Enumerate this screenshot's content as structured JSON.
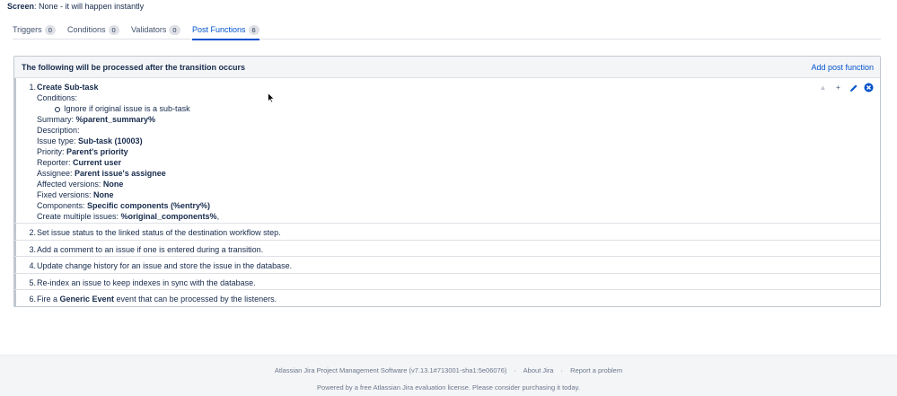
{
  "screen": {
    "label": "Screen",
    "value": ": None - it will happen instantly"
  },
  "tabs": [
    {
      "label": "Triggers",
      "count": "0"
    },
    {
      "label": "Conditions",
      "count": "0"
    },
    {
      "label": "Validators",
      "count": "0"
    },
    {
      "label": "Post Functions",
      "count": "6"
    }
  ],
  "panel": {
    "title": "The following will be processed after the transition occurs",
    "add_label": "Add post function"
  },
  "function1": {
    "num": "1.",
    "title": "Create Sub-task",
    "conditions_label": "Conditions:",
    "condition_item": "Ignore if original issue is a sub-task",
    "fields": [
      {
        "label": "Summary: ",
        "value": "%parent_summary%"
      },
      {
        "label": "Description:",
        "value": ""
      },
      {
        "label": "Issue type: ",
        "value": "Sub-task (10003)"
      },
      {
        "label": "Priority: ",
        "value": "Parent's priority"
      },
      {
        "label": "Reporter: ",
        "value": "Current user"
      },
      {
        "label": "Assignee: ",
        "value": "Parent issue's assignee"
      },
      {
        "label": "Affected versions: ",
        "value": "None"
      },
      {
        "label": "Fixed versions: ",
        "value": "None"
      },
      {
        "label": "Components: ",
        "value": "Specific components (%entry%)"
      },
      {
        "label": "Create multiple issues: ",
        "value": "%original_components%",
        "suffix": ","
      }
    ]
  },
  "functions": [
    {
      "num": "2.",
      "text": "Set issue status to the linked status of the destination workflow step."
    },
    {
      "num": "3.",
      "text": "Add a comment to an issue if one is entered during a transition."
    },
    {
      "num": "4.",
      "text": "Update change history for an issue and store the issue in the database."
    },
    {
      "num": "5.",
      "text": "Re-index an issue to keep indexes in sync with the database."
    },
    {
      "num": "6.",
      "pre": "Fire a ",
      "bold": "Generic Event",
      "post": " event that can be processed by the listeners."
    }
  ],
  "actions": {
    "move_up": "▲",
    "move_down": "+"
  },
  "footer": {
    "software": "Atlassian Jira Project Management Software (v7.13.1#713001-sha1:5e06076)",
    "about": "About Jira",
    "report": "Report a problem",
    "license": "Powered by a free Atlassian Jira evaluation license. Please consider purchasing it today.",
    "sep": "·"
  },
  "colors": {
    "accent": "#0052cc",
    "delete": "#0052cc"
  }
}
